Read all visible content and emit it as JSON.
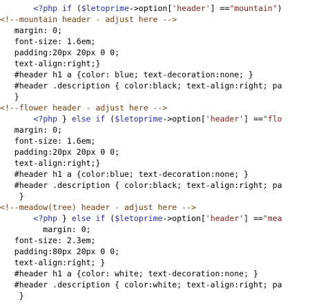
{
  "editor": {
    "lines": [
      {
        "segments": [
          {
            "t": "       ",
            "c": "plain"
          },
          {
            "t": "<?php",
            "c": "php"
          },
          {
            "t": " ",
            "c": "plain"
          },
          {
            "t": "if",
            "c": "kw"
          },
          {
            "t": " (",
            "c": "plain"
          },
          {
            "t": "$letoprime",
            "c": "var"
          },
          {
            "t": "->option[",
            "c": "plain"
          },
          {
            "t": "'header'",
            "c": "str"
          },
          {
            "t": "] ==",
            "c": "plain"
          },
          {
            "t": "\"mountain\"",
            "c": "str"
          },
          {
            "t": ")",
            "c": "plain"
          }
        ]
      },
      {
        "segments": [
          {
            "t": "<!--mountain header - adjust here -->",
            "c": "cmt"
          }
        ]
      },
      {
        "segments": [
          {
            "t": "   margin: 0;",
            "c": "plain"
          }
        ]
      },
      {
        "segments": [
          {
            "t": "   font-size: 1.6em;",
            "c": "plain"
          }
        ]
      },
      {
        "segments": [
          {
            "t": "   padding:20px 20px 0 0;",
            "c": "plain"
          }
        ]
      },
      {
        "segments": [
          {
            "t": "   text-align:right;}",
            "c": "plain"
          }
        ]
      },
      {
        "segments": [
          {
            "t": "   #header h1 a {color: blue; text-decoration:none; }",
            "c": "plain"
          }
        ]
      },
      {
        "segments": [
          {
            "t": "   #header .description { color:black; text-align:right; pa",
            "c": "plain"
          }
        ]
      },
      {
        "segments": [
          {
            "t": "   }",
            "c": "plain"
          }
        ]
      },
      {
        "segments": [
          {
            "t": "<!--flower header - adjust here -->",
            "c": "cmt"
          }
        ]
      },
      {
        "segments": [
          {
            "t": "       ",
            "c": "plain"
          },
          {
            "t": "<?php",
            "c": "php"
          },
          {
            "t": " } ",
            "c": "plain"
          },
          {
            "t": "else if",
            "c": "kw"
          },
          {
            "t": " (",
            "c": "plain"
          },
          {
            "t": "$letoprime",
            "c": "var"
          },
          {
            "t": "->option[",
            "c": "plain"
          },
          {
            "t": "'header'",
            "c": "str"
          },
          {
            "t": "] ==",
            "c": "plain"
          },
          {
            "t": "\"flo",
            "c": "str"
          }
        ]
      },
      {
        "segments": [
          {
            "t": "   margin: 0;",
            "c": "plain"
          }
        ]
      },
      {
        "segments": [
          {
            "t": "   font-size: 1.6em;",
            "c": "plain"
          }
        ]
      },
      {
        "segments": [
          {
            "t": "   padding:20px 20px 0 0;",
            "c": "plain"
          }
        ]
      },
      {
        "segments": [
          {
            "t": "   text-align:right;}",
            "c": "plain"
          }
        ]
      },
      {
        "segments": [
          {
            "t": "   #header h1 a {color:blue; text-decoration:none; }",
            "c": "plain"
          }
        ]
      },
      {
        "segments": [
          {
            "t": "   #header .description { color:black; text-align:right; pa",
            "c": "plain"
          }
        ]
      },
      {
        "segments": [
          {
            "t": "    }",
            "c": "plain"
          }
        ]
      },
      {
        "segments": [
          {
            "t": "<!--meadow(tree) header - adjust here -->",
            "c": "cmt"
          }
        ]
      },
      {
        "segments": [
          {
            "t": "       ",
            "c": "plain"
          },
          {
            "t": "<?php",
            "c": "php"
          },
          {
            "t": " } ",
            "c": "plain"
          },
          {
            "t": "else if",
            "c": "kw"
          },
          {
            "t": " (",
            "c": "plain"
          },
          {
            "t": "$letoprime",
            "c": "var"
          },
          {
            "t": "->option[",
            "c": "plain"
          },
          {
            "t": "'header'",
            "c": "str"
          },
          {
            "t": "] ==",
            "c": "plain"
          },
          {
            "t": "\"mea",
            "c": "str"
          }
        ]
      },
      {
        "segments": [
          {
            "t": "         margin: 0;",
            "c": "plain"
          }
        ]
      },
      {
        "segments": [
          {
            "t": "   font-size: 2.3em;",
            "c": "plain"
          }
        ]
      },
      {
        "segments": [
          {
            "t": "   padding:80px 20px 0 0;",
            "c": "plain"
          }
        ]
      },
      {
        "segments": [
          {
            "t": "   text-align:right; }",
            "c": "plain"
          }
        ]
      },
      {
        "segments": [
          {
            "t": "   #header h1 a {color: white; text-decoration:none; }",
            "c": "plain"
          }
        ]
      },
      {
        "segments": [
          {
            "t": "   #header .description { color:white; text-align:right; pa",
            "c": "plain"
          }
        ]
      },
      {
        "segments": [
          {
            "t": "    }",
            "c": "plain"
          }
        ]
      }
    ]
  },
  "colors": {
    "background": "#ffffff",
    "text": "#000000",
    "keyword": "#2a2ab8",
    "string": "#8b1a1a",
    "comment": "#7a3d0d"
  }
}
